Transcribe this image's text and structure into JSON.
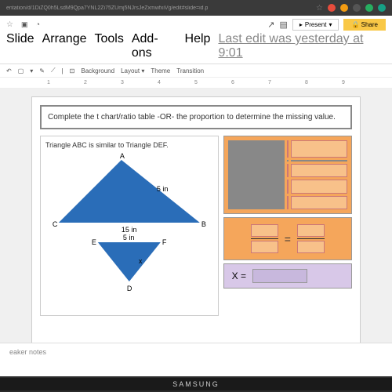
{
  "browser": {
    "url": "entation/d/1DiZQ0h5LsdM9Qpa7YNL2Zi75ZUmj5NJrsJeZxmwfxiVg/edit#slide=id.p"
  },
  "app": {
    "menu": [
      "Slide",
      "Arrange",
      "Tools",
      "Add-ons",
      "Help"
    ],
    "last_edit": "Last edit was yesterday at 9:01",
    "present": "Present",
    "share": "Share"
  },
  "toolbar": {
    "background": "Background",
    "layout": "Layout",
    "theme": "Theme",
    "transition": "Transition"
  },
  "ruler": [
    "1",
    "2",
    "3",
    "4",
    "5",
    "6",
    "7",
    "8",
    "9"
  ],
  "slide": {
    "instruction": "Complete the t chart/ratio table -OR- the proportion to determine the missing value.",
    "subtitle": "Triangle ABC is similar to Triangle DEF.",
    "labels": {
      "A": "A",
      "B": "B",
      "C": "C",
      "D": "D",
      "E": "E",
      "F": "F"
    },
    "measurements": {
      "ab": "5 in",
      "cb": "15 in",
      "ef": "5 in",
      "x": "x"
    },
    "equals": "=",
    "answer_label": "X ="
  },
  "notes": "eaker notes",
  "brand": "SAMSUNG",
  "chart_data": {
    "type": "diagram",
    "title": "Similar Triangles ABC ~ DEF",
    "triangle_ABC": {
      "AB": 5,
      "CB": 15,
      "unit": "in"
    },
    "triangle_DEF": {
      "EF": 5,
      "ED_or_FD": "x",
      "unit": "in"
    },
    "unknown": "x"
  }
}
